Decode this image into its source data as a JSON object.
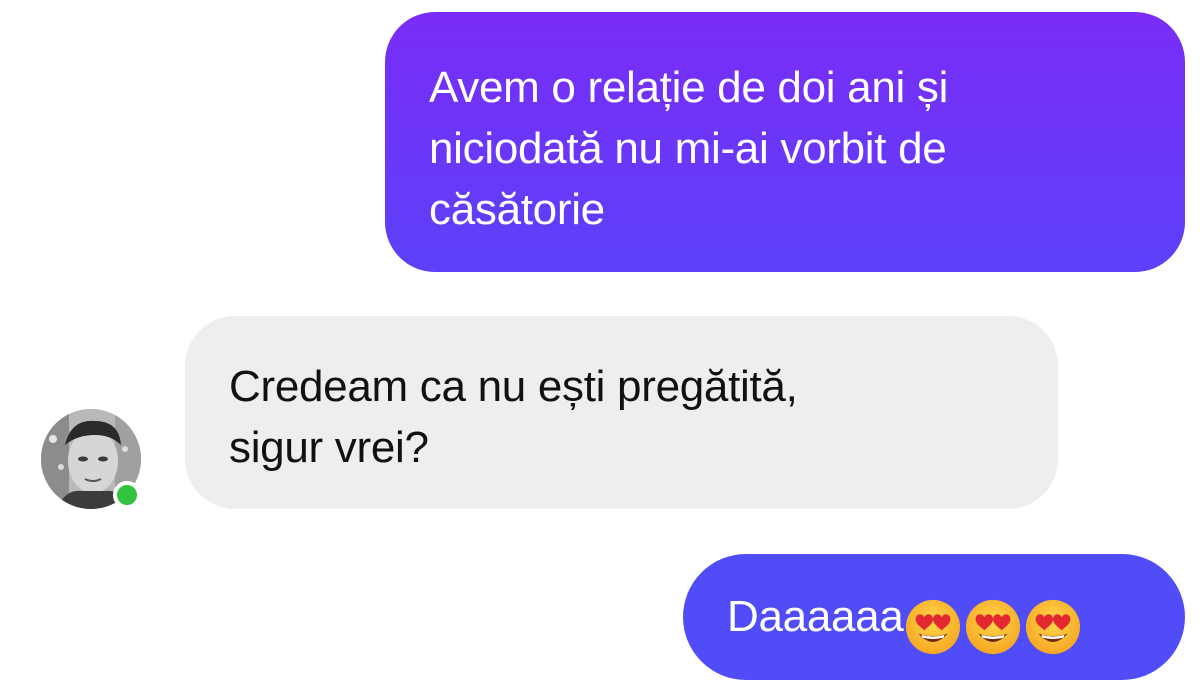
{
  "conversation": {
    "messages": [
      {
        "direction": "sent",
        "lines": [
          "Avem o relație de doi ani și",
          "niciodată nu mi-ai vorbit de",
          "căsătorie"
        ]
      },
      {
        "direction": "received",
        "lines": [
          "Credeam ca nu ești pregătită,",
          "sigur vrei?"
        ]
      },
      {
        "direction": "sent",
        "text": "Daaaaaa",
        "emojis": [
          "heart-eyes-emoji",
          "heart-eyes-emoji",
          "heart-eyes-emoji"
        ]
      }
    ],
    "contact": {
      "avatar_icon": "contact-avatar",
      "status": "online"
    },
    "colors": {
      "sent_bubble_top": "#7a2cf6",
      "sent_bubble_bottom": "#5c41f9",
      "sent_bubble_last": "#4f4cf8",
      "received_bubble": "#eeeeee",
      "online_indicator": "#31c23f"
    }
  }
}
